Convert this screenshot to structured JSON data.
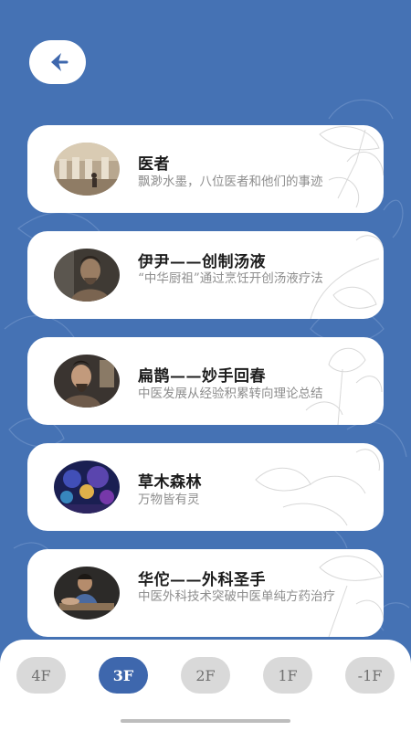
{
  "header": {
    "back_icon": "back-arrow-icon"
  },
  "exhibits": [
    {
      "title": "医者",
      "description": "飘渺水墨，八位医者和他们的事迹",
      "image": "museum-hall-photo"
    },
    {
      "title": "伊尹——创制汤液",
      "description": "“中华厨祖”通过烹饪开创汤液疗法",
      "image": "yi-yin-statue-photo"
    },
    {
      "title": "扁鹊——妙手回春",
      "description": "中医发展从经验积累转向理论总结",
      "image": "bian-que-portrait-photo"
    },
    {
      "title": "草木森林",
      "description": "万物皆有灵",
      "image": "glowing-plants-photo"
    },
    {
      "title": "华佗——外科圣手",
      "description": "中医外科技术突破中医单纯方药治疗",
      "image": "hua-tuo-scene-photo"
    }
  ],
  "floors": {
    "items": [
      "4F",
      "3F",
      "2F",
      "1F",
      "-1F"
    ],
    "selected": "3F"
  },
  "colors": {
    "background": "#4572b4",
    "accent": "#3e67ad",
    "card": "#ffffff",
    "floor_inactive": "#d9d9d9"
  }
}
